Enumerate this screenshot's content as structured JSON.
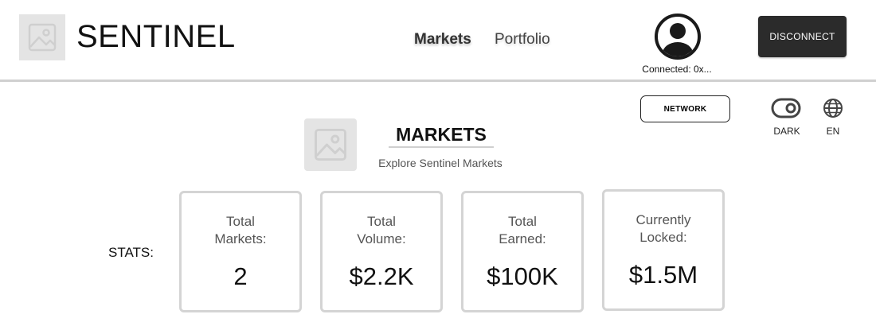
{
  "header": {
    "app_title": "SENTINEL",
    "nav": [
      {
        "label": "Markets",
        "active": true
      },
      {
        "label": "Portfolio",
        "active": false
      }
    ],
    "connected_text": "Connected: 0x...",
    "disconnect_label": "DISCONNECT",
    "avatar_icon": "user-avatar-icon",
    "logo_icon": "image-placeholder-icon"
  },
  "controls": {
    "network_label": "NETWORK",
    "theme_label": "DARK",
    "theme_icon": "toggle-icon",
    "language_label": "EN",
    "language_icon": "globe-icon"
  },
  "section": {
    "title": "MARKETS",
    "subtitle": "Explore Sentinel Markets",
    "image_icon": "image-placeholder-icon"
  },
  "stats": {
    "label": "STATS:",
    "cards": [
      {
        "title_line1": "Total",
        "title_line2": "Markets:",
        "value": "2"
      },
      {
        "title_line1": "Total",
        "title_line2": "Volume:",
        "value": "$2.2K"
      },
      {
        "title_line1": "Total",
        "title_line2": "Earned:",
        "value": "$100K"
      },
      {
        "title_line1": "Currently",
        "title_line2": "Locked:",
        "value": "$1.5M"
      }
    ]
  },
  "colors": {
    "primary_button": "#2b2b2b",
    "placeholder_bg": "#e4e4e4",
    "card_border": "#d4d4d4"
  }
}
